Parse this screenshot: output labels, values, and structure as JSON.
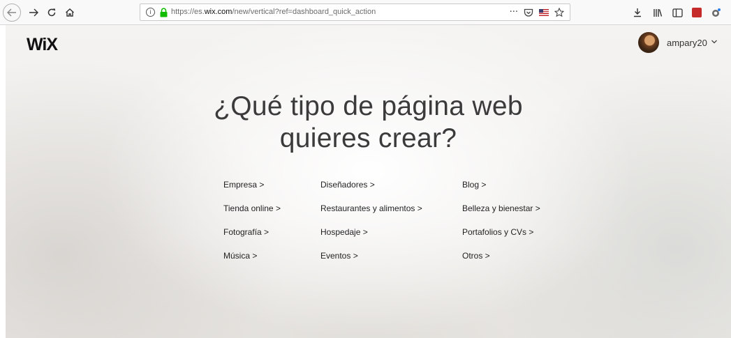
{
  "browser": {
    "url_prefix": "https://es.",
    "url_domain": "wix.com",
    "url_suffix": "/new/vertical?ref=dashboard_quick_action",
    "info_glyph": "i",
    "more_glyph": "···"
  },
  "header": {
    "logo": "WiX",
    "username": "ampary20"
  },
  "main": {
    "title_line1": "¿Qué tipo de página web",
    "title_line2": "quieres crear?"
  },
  "categories": {
    "col1": [
      "Empresa >",
      "Tienda online >",
      "Fotografía >",
      "Música >"
    ],
    "col2": [
      "Diseñadores >",
      "Restaurantes y alimentos >",
      "Hospedaje >",
      "Eventos >"
    ],
    "col3": [
      "Blog >",
      "Belleza y bienestar >",
      "Portafolios y CVs >",
      "Otros >"
    ]
  },
  "icons": {
    "back": "back-arrow-icon",
    "forward": "forward-arrow-icon",
    "reload": "reload-icon",
    "home": "home-icon",
    "lock": "lock-icon",
    "pocket": "pocket-icon",
    "bookmark": "star-icon",
    "download": "download-icon",
    "library": "library-icon",
    "sidebar": "sidebar-icon",
    "menu": "hamburger-menu-icon"
  },
  "colors": {
    "lock_green": "#12bc00",
    "text": "#222222"
  }
}
